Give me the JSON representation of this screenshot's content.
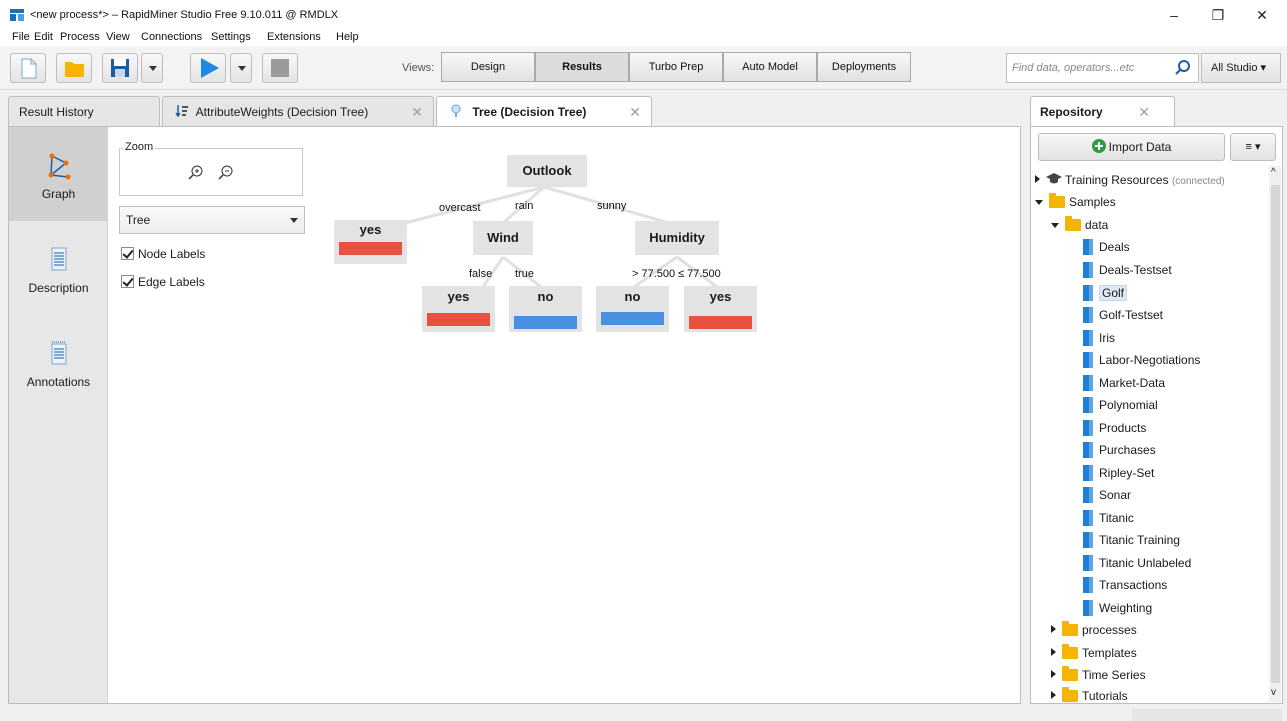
{
  "window": {
    "title": "<new process*> – RapidMiner Studio Free 9.10.011 @ RMDLX",
    "minimize": "–",
    "maximize": "❐",
    "close": "✕"
  },
  "menu": [
    "File",
    "Edit",
    "Process",
    "View",
    "Connections",
    "Settings",
    "Extensions",
    "Help"
  ],
  "toolbar": {
    "views_label": "Views:",
    "views": [
      "Design",
      "Results",
      "Turbo Prep",
      "Auto Model",
      "Deployments"
    ],
    "active_view": "Results",
    "search_placeholder": "Find data, operators...etc",
    "scope": "All Studio ▾"
  },
  "tabs": [
    {
      "label": "Result History"
    },
    {
      "label": "AttributeWeights (Decision Tree)"
    },
    {
      "label": "Tree (Decision Tree)"
    }
  ],
  "left_nav": [
    "Graph",
    "Description",
    "Annotations"
  ],
  "controls": {
    "zoom_label": "Zoom",
    "layout_select": "Tree",
    "node_labels": "Node Labels",
    "edge_labels": "Edge Labels"
  },
  "tree": {
    "root": "Outlook",
    "wind": "Wind",
    "humidity": "Humidity",
    "leaf_overcast": "yes",
    "leaf_wind_false": "yes",
    "leaf_wind_true": "no",
    "leaf_hum_gt": "no",
    "leaf_hum_le": "yes",
    "edge_overcast": "overcast",
    "edge_rain": "rain",
    "edge_sunny": "sunny",
    "edge_false": "false",
    "edge_true": "true",
    "edge_gt": "> 77.500",
    "edge_le": "≤ 77.500",
    "color_yes": "#e8513f",
    "color_no": "#4a8fe0"
  },
  "repository": {
    "tab_label": "Repository",
    "import_label": "Import Data",
    "menu_label": "≡ ▾",
    "training": "Training Resources",
    "training_status": "(connected)",
    "samples": "Samples",
    "data": "data",
    "items": [
      "Deals",
      "Deals-Testset",
      "Golf",
      "Golf-Testset",
      "Iris",
      "Labor-Negotiations",
      "Market-Data",
      "Polynomial",
      "Products",
      "Purchases",
      "Ripley-Set",
      "Sonar",
      "Titanic",
      "Titanic Training",
      "Titanic Unlabeled",
      "Transactions",
      "Weighting"
    ],
    "selected": "Golf",
    "folders": [
      "processes",
      "Templates",
      "Time Series",
      "Tutorials"
    ]
  }
}
